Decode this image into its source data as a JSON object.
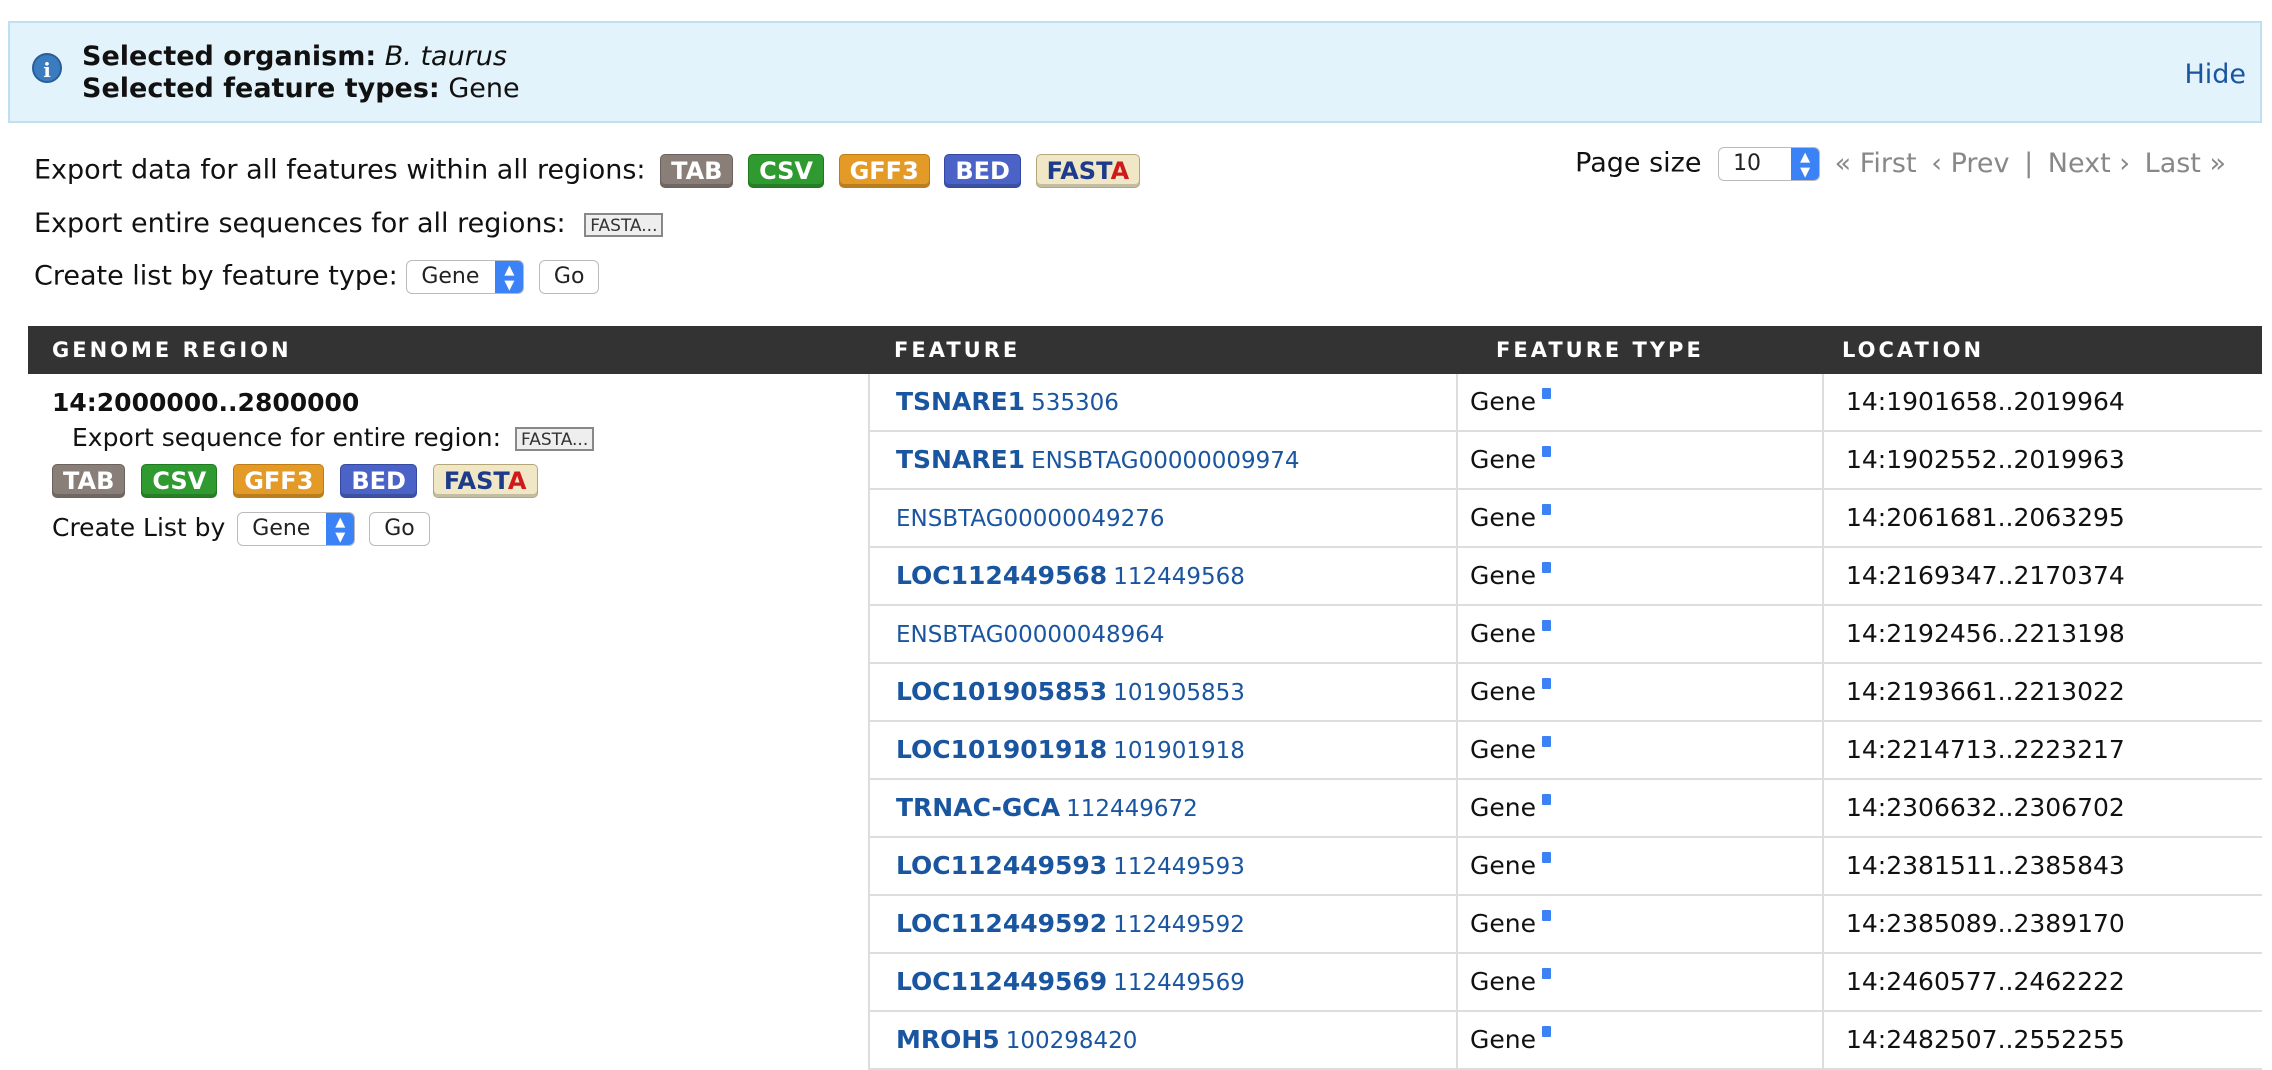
{
  "info": {
    "organism_label": "Selected organism:",
    "organism_value": "B. taurus",
    "feature_types_label": "Selected feature types:",
    "feature_types_value": "Gene",
    "hide": "Hide"
  },
  "export_all": {
    "label": "Export data for all features within all regions:",
    "buttons": [
      "TAB",
      "CSV",
      "GFF3",
      "BED",
      "FASTA"
    ]
  },
  "export_sequences": {
    "label": "Export entire sequences for all regions:",
    "button": "FASTA..."
  },
  "create_list": {
    "label": "Create list by feature type:",
    "selected": "Gene",
    "go": "Go"
  },
  "pager": {
    "label": "Page size",
    "value": "10",
    "first": "« First",
    "prev": "‹ Prev",
    "sep": "|",
    "next": "Next ›",
    "last": "Last »"
  },
  "table": {
    "headers": [
      "GENOME REGION",
      "FEATURE",
      "FEATURE TYPE",
      "LOCATION"
    ],
    "region": {
      "title": "14:2000000..2800000",
      "export_label": "Export sequence for entire region:",
      "export_button": "FASTA...",
      "buttons": [
        "TAB",
        "CSV",
        "GFF3",
        "BED",
        "FASTA"
      ],
      "create_list_label": "Create List by",
      "create_list_selected": "Gene",
      "go": "Go"
    },
    "rows": [
      {
        "symbol": "TSNARE1",
        "id": "535306",
        "type": "Gene",
        "location": "14:1901658..2019964"
      },
      {
        "symbol": "TSNARE1",
        "id": "ENSBTAG00000009974",
        "type": "Gene",
        "location": "14:1902552..2019963"
      },
      {
        "symbol": "",
        "id": "ENSBTAG00000049276",
        "type": "Gene",
        "location": "14:2061681..2063295"
      },
      {
        "symbol": "LOC112449568",
        "id": "112449568",
        "type": "Gene",
        "location": "14:2169347..2170374"
      },
      {
        "symbol": "",
        "id": "ENSBTAG00000048964",
        "type": "Gene",
        "location": "14:2192456..2213198"
      },
      {
        "symbol": "LOC101905853",
        "id": "101905853",
        "type": "Gene",
        "location": "14:2193661..2213022"
      },
      {
        "symbol": "LOC101901918",
        "id": "101901918",
        "type": "Gene",
        "location": "14:2214713..2223217"
      },
      {
        "symbol": "TRNAC-GCA",
        "id": "112449672",
        "type": "Gene",
        "location": "14:2306632..2306702"
      },
      {
        "symbol": "LOC112449593",
        "id": "112449593",
        "type": "Gene",
        "location": "14:2381511..2385843"
      },
      {
        "symbol": "LOC112449592",
        "id": "112449592",
        "type": "Gene",
        "location": "14:2385089..2389170"
      },
      {
        "symbol": "LOC112449569",
        "id": "112449569",
        "type": "Gene",
        "location": "14:2460577..2462222"
      },
      {
        "symbol": "MROH5",
        "id": "100298420",
        "type": "Gene",
        "location": "14:2482507..2552255"
      }
    ]
  }
}
